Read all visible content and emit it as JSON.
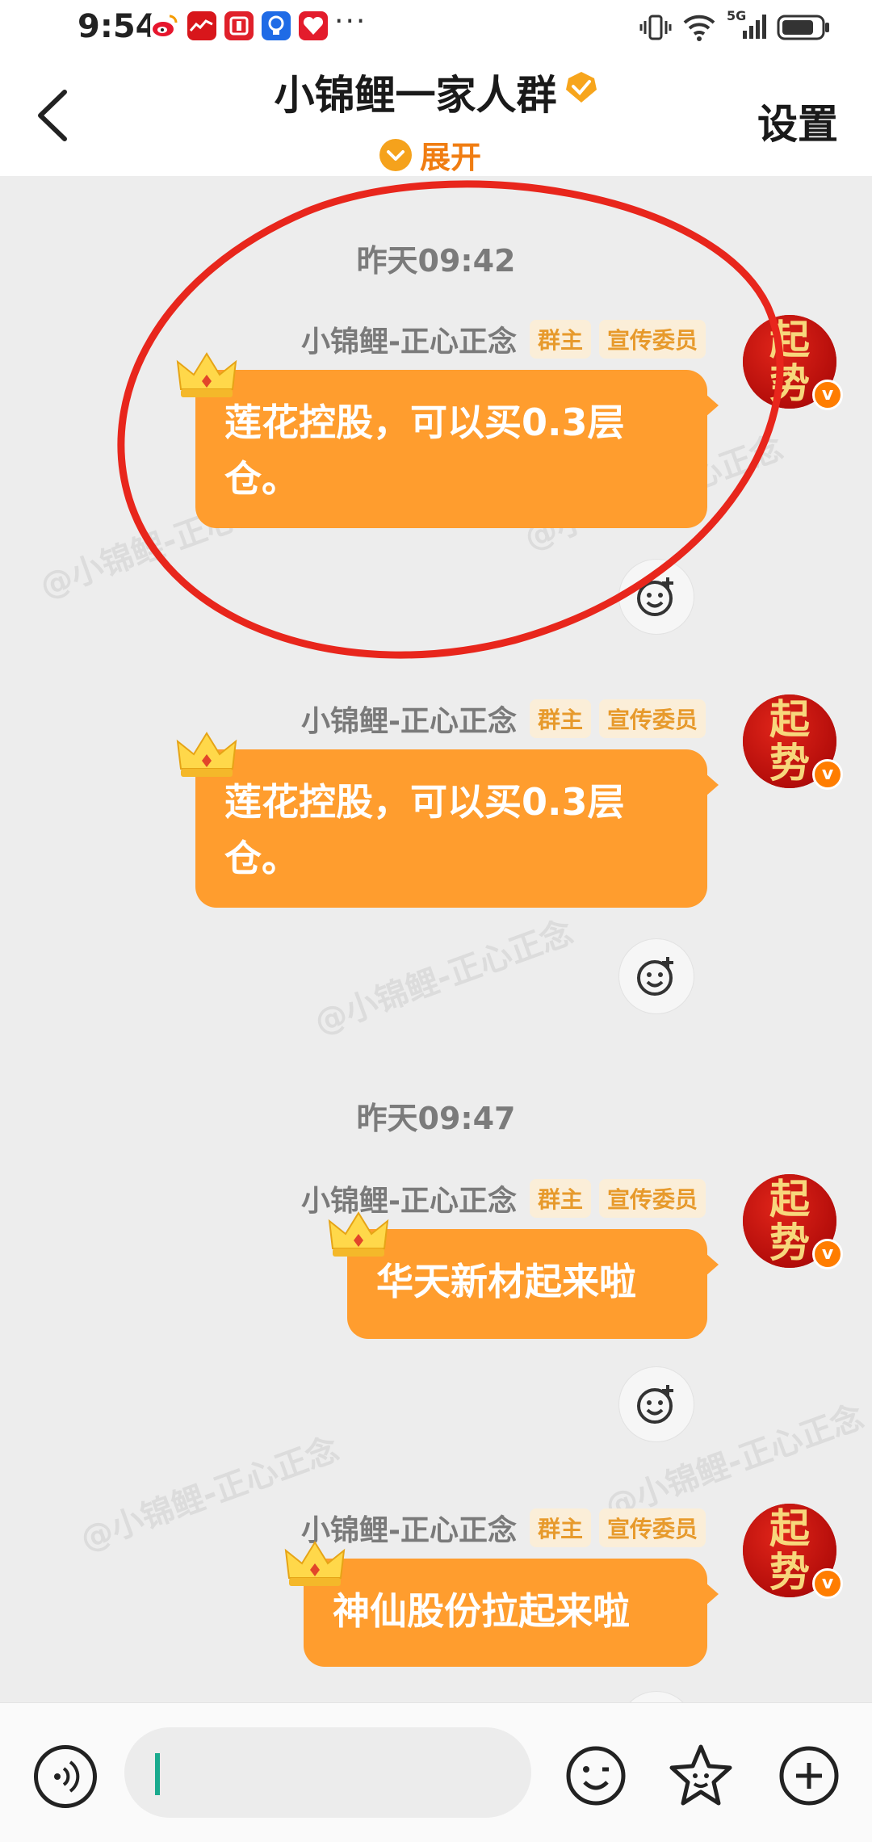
{
  "status_bar": {
    "time": "9:54",
    "app_icons": [
      "weibo-icon",
      "stock-app-icon",
      "news-app-icon",
      "bulb-app-icon",
      "heart-app-icon"
    ],
    "more": "···",
    "signal": "5G"
  },
  "header": {
    "title": "小锦鲤一家人群",
    "expand_label": "展开",
    "settings_label": "设置"
  },
  "chat": {
    "watermark": "@小锦鲤-正心正念",
    "timestamps": [
      "昨天09:42",
      "昨天09:47"
    ],
    "messages": [
      {
        "sender": "小锦鲤-正心正念",
        "tags": [
          "群主",
          "宣传委员"
        ],
        "text": "莲花控股，可以买0.3层仓。",
        "avatar_text": "起势"
      },
      {
        "sender": "小锦鲤-正心正念",
        "tags": [
          "群主",
          "宣传委员"
        ],
        "text": "莲花控股，可以买0.3层仓。",
        "avatar_text": "起势"
      },
      {
        "sender": "小锦鲤-正心正念",
        "tags": [
          "群主",
          "宣传委员"
        ],
        "text": "华天新材起来啦",
        "avatar_text": "起势"
      },
      {
        "sender": "小锦鲤-正心正念",
        "tags": [
          "群主",
          "宣传委员"
        ],
        "text": "神仙股份拉起来啦",
        "avatar_text": "起势"
      }
    ]
  },
  "input": {
    "value": "",
    "placeholder": ""
  },
  "colors": {
    "bubble": "#ff9d2e",
    "accent": "#f07d12",
    "annotation_circle": "#e8261c"
  }
}
